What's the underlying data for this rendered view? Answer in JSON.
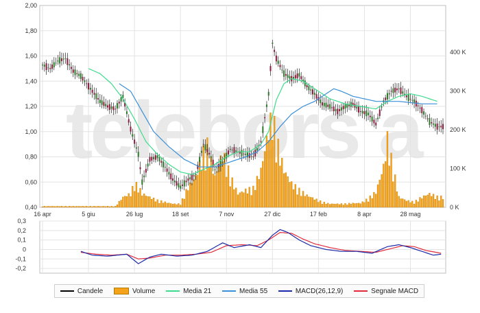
{
  "chart_data": [
    {
      "type": "candlestick",
      "title": "",
      "ylabel": "",
      "xlabel": "",
      "ylim": [
        0.4,
        2.0
      ],
      "y_ticks": [
        "2,00",
        "1,80",
        "1,60",
        "1,40",
        "1,20",
        "1,00",
        "0,80",
        "0,60",
        "0,40"
      ],
      "volume_ylim": [
        0,
        520
      ],
      "volume_ticks": [
        "400 K",
        "300 K",
        "200 K",
        "100 K",
        "0 K"
      ],
      "x_tick_labels": [
        "16 apr",
        "5 giu",
        "26 lug",
        "18 set",
        "7 nov",
        "27 dic",
        "17 feb",
        "8 apr",
        "28 mag"
      ],
      "grid": true,
      "watermark": "telebors a",
      "price_knots": [
        [
          0,
          1.53
        ],
        [
          4,
          1.5
        ],
        [
          8,
          1.56
        ],
        [
          12,
          1.58
        ],
        [
          16,
          1.48
        ],
        [
          20,
          1.44
        ],
        [
          26,
          1.32
        ],
        [
          30,
          1.24
        ],
        [
          34,
          1.2
        ],
        [
          38,
          1.18
        ],
        [
          42,
          1.28
        ],
        [
          46,
          1.02
        ],
        [
          50,
          0.82
        ],
        [
          52,
          0.6
        ],
        [
          56,
          0.78
        ],
        [
          60,
          0.8
        ],
        [
          64,
          0.72
        ],
        [
          68,
          0.62
        ],
        [
          72,
          0.56
        ],
        [
          76,
          0.62
        ],
        [
          80,
          0.66
        ],
        [
          84,
          0.9
        ],
        [
          88,
          0.8
        ],
        [
          90,
          0.7
        ],
        [
          94,
          0.76
        ],
        [
          98,
          0.86
        ],
        [
          102,
          0.84
        ],
        [
          106,
          0.82
        ],
        [
          110,
          0.8
        ],
        [
          114,
          0.92
        ],
        [
          118,
          1.3
        ],
        [
          120,
          1.7
        ],
        [
          122,
          1.58
        ],
        [
          126,
          1.46
        ],
        [
          130,
          1.42
        ],
        [
          134,
          1.45
        ],
        [
          138,
          1.36
        ],
        [
          142,
          1.3
        ],
        [
          146,
          1.22
        ],
        [
          150,
          1.2
        ],
        [
          154,
          1.16
        ],
        [
          158,
          1.2
        ],
        [
          162,
          1.22
        ],
        [
          166,
          1.16
        ],
        [
          170,
          1.14
        ],
        [
          174,
          1.06
        ],
        [
          178,
          1.24
        ],
        [
          182,
          1.32
        ],
        [
          186,
          1.34
        ],
        [
          190,
          1.28
        ],
        [
          194,
          1.24
        ],
        [
          198,
          1.17
        ],
        [
          202,
          1.08
        ],
        [
          206,
          1.04
        ]
      ],
      "volume_knots": [
        [
          0,
          3
        ],
        [
          38,
          3
        ],
        [
          42,
          30
        ],
        [
          46,
          40
        ],
        [
          48,
          70
        ],
        [
          50,
          60
        ],
        [
          52,
          40
        ],
        [
          56,
          30
        ],
        [
          60,
          20
        ],
        [
          64,
          15
        ],
        [
          68,
          10
        ],
        [
          72,
          10
        ],
        [
          76,
          60
        ],
        [
          80,
          90
        ],
        [
          84,
          160
        ],
        [
          86,
          180
        ],
        [
          90,
          90
        ],
        [
          94,
          160
        ],
        [
          98,
          90
        ],
        [
          102,
          40
        ],
        [
          106,
          50
        ],
        [
          110,
          55
        ],
        [
          114,
          110
        ],
        [
          118,
          230
        ],
        [
          120,
          270
        ],
        [
          122,
          200
        ],
        [
          126,
          110
        ],
        [
          130,
          70
        ],
        [
          134,
          50
        ],
        [
          138,
          35
        ],
        [
          142,
          25
        ],
        [
          146,
          15
        ],
        [
          150,
          10
        ],
        [
          154,
          10
        ],
        [
          158,
          10
        ],
        [
          162,
          12
        ],
        [
          166,
          12
        ],
        [
          170,
          25
        ],
        [
          174,
          45
        ],
        [
          178,
          120
        ],
        [
          180,
          200
        ],
        [
          182,
          140
        ],
        [
          186,
          30
        ],
        [
          190,
          20
        ],
        [
          194,
          15
        ],
        [
          198,
          30
        ],
        [
          202,
          40
        ],
        [
          206,
          30
        ]
      ],
      "ma21_knots": [
        [
          24,
          1.5
        ],
        [
          30,
          1.46
        ],
        [
          36,
          1.38
        ],
        [
          42,
          1.26
        ],
        [
          48,
          1.1
        ],
        [
          54,
          0.92
        ],
        [
          60,
          0.82
        ],
        [
          66,
          0.74
        ],
        [
          72,
          0.68
        ],
        [
          78,
          0.66
        ],
        [
          84,
          0.7
        ],
        [
          90,
          0.74
        ],
        [
          96,
          0.8
        ],
        [
          102,
          0.84
        ],
        [
          108,
          0.84
        ],
        [
          114,
          0.9
        ],
        [
          118,
          1.0
        ],
        [
          122,
          1.25
        ],
        [
          126,
          1.38
        ],
        [
          130,
          1.42
        ],
        [
          136,
          1.4
        ],
        [
          142,
          1.34
        ],
        [
          150,
          1.26
        ],
        [
          158,
          1.22
        ],
        [
          166,
          1.2
        ],
        [
          174,
          1.18
        ],
        [
          180,
          1.24
        ],
        [
          186,
          1.28
        ],
        [
          192,
          1.3
        ],
        [
          198,
          1.28
        ],
        [
          206,
          1.24
        ]
      ],
      "ma55_knots": [
        [
          40,
          1.38
        ],
        [
          46,
          1.32
        ],
        [
          52,
          1.16
        ],
        [
          58,
          1.0
        ],
        [
          66,
          0.88
        ],
        [
          74,
          0.78
        ],
        [
          82,
          0.72
        ],
        [
          90,
          0.72
        ],
        [
          98,
          0.76
        ],
        [
          106,
          0.8
        ],
        [
          112,
          0.84
        ],
        [
          118,
          0.92
        ],
        [
          124,
          1.04
        ],
        [
          130,
          1.14
        ],
        [
          136,
          1.2
        ],
        [
          142,
          1.24
        ],
        [
          148,
          1.3
        ],
        [
          152,
          1.34
        ],
        [
          156,
          1.32
        ],
        [
          162,
          1.28
        ],
        [
          168,
          1.26
        ],
        [
          174,
          1.24
        ],
        [
          180,
          1.24
        ],
        [
          186,
          1.24
        ],
        [
          192,
          1.23
        ],
        [
          198,
          1.22
        ],
        [
          206,
          1.22
        ]
      ]
    },
    {
      "type": "line",
      "title": "",
      "ylim": [
        -0.25,
        0.3
      ],
      "y_ticks": [
        "0,3",
        "0,2",
        "0,1",
        "0",
        "-0,1",
        "-0,2"
      ],
      "macd_knots": [
        [
          20,
          -0.02
        ],
        [
          26,
          -0.06
        ],
        [
          34,
          -0.07
        ],
        [
          44,
          -0.05
        ],
        [
          50,
          -0.15
        ],
        [
          56,
          -0.08
        ],
        [
          62,
          -0.05
        ],
        [
          70,
          -0.07
        ],
        [
          78,
          -0.06
        ],
        [
          86,
          -0.02
        ],
        [
          94,
          0.07
        ],
        [
          100,
          0.02
        ],
        [
          108,
          0.05
        ],
        [
          114,
          0.02
        ],
        [
          120,
          0.15
        ],
        [
          124,
          0.21
        ],
        [
          128,
          0.18
        ],
        [
          134,
          0.1
        ],
        [
          140,
          0.04
        ],
        [
          148,
          0.0
        ],
        [
          156,
          -0.02
        ],
        [
          164,
          -0.02
        ],
        [
          172,
          -0.04
        ],
        [
          180,
          0.03
        ],
        [
          186,
          0.05
        ],
        [
          192,
          0.02
        ],
        [
          198,
          -0.02
        ],
        [
          204,
          -0.06
        ],
        [
          208,
          -0.05
        ]
      ],
      "signal_knots": [
        [
          20,
          -0.03
        ],
        [
          28,
          -0.05
        ],
        [
          36,
          -0.06
        ],
        [
          44,
          -0.05
        ],
        [
          50,
          -0.1
        ],
        [
          56,
          -0.09
        ],
        [
          64,
          -0.06
        ],
        [
          72,
          -0.06
        ],
        [
          80,
          -0.05
        ],
        [
          88,
          -0.03
        ],
        [
          96,
          0.04
        ],
        [
          104,
          0.05
        ],
        [
          112,
          0.04
        ],
        [
          118,
          0.1
        ],
        [
          124,
          0.18
        ],
        [
          130,
          0.17
        ],
        [
          136,
          0.11
        ],
        [
          142,
          0.06
        ],
        [
          150,
          0.02
        ],
        [
          158,
          -0.01
        ],
        [
          166,
          -0.02
        ],
        [
          174,
          -0.03
        ],
        [
          182,
          0.01
        ],
        [
          188,
          0.04
        ],
        [
          194,
          0.03
        ],
        [
          200,
          -0.01
        ],
        [
          208,
          -0.04
        ]
      ]
    }
  ],
  "colors": {
    "candle_up": "#2a7a2a",
    "candle_down": "#8b1a3c",
    "volume": "#f5a31a",
    "ma21": "#3cdc8c",
    "ma55": "#3a8fd8",
    "macd": "#1a2aa8",
    "signal": "#e02a3a",
    "grid": "#e3e3e3",
    "frame": "#bfbfbf"
  },
  "legend": [
    {
      "label": "Candele",
      "kind": "line",
      "color": "#000000"
    },
    {
      "label": "Volume",
      "kind": "box",
      "color": "#f5a31a"
    },
    {
      "label": "Media 21",
      "kind": "line",
      "color": "#3cdc8c"
    },
    {
      "label": "Media 55",
      "kind": "line",
      "color": "#3a8fd8"
    },
    {
      "label": "MACD(26,12,9)",
      "kind": "line",
      "color": "#1a2aa8"
    },
    {
      "label": "Segnale MACD",
      "kind": "line",
      "color": "#e02a3a"
    }
  ]
}
